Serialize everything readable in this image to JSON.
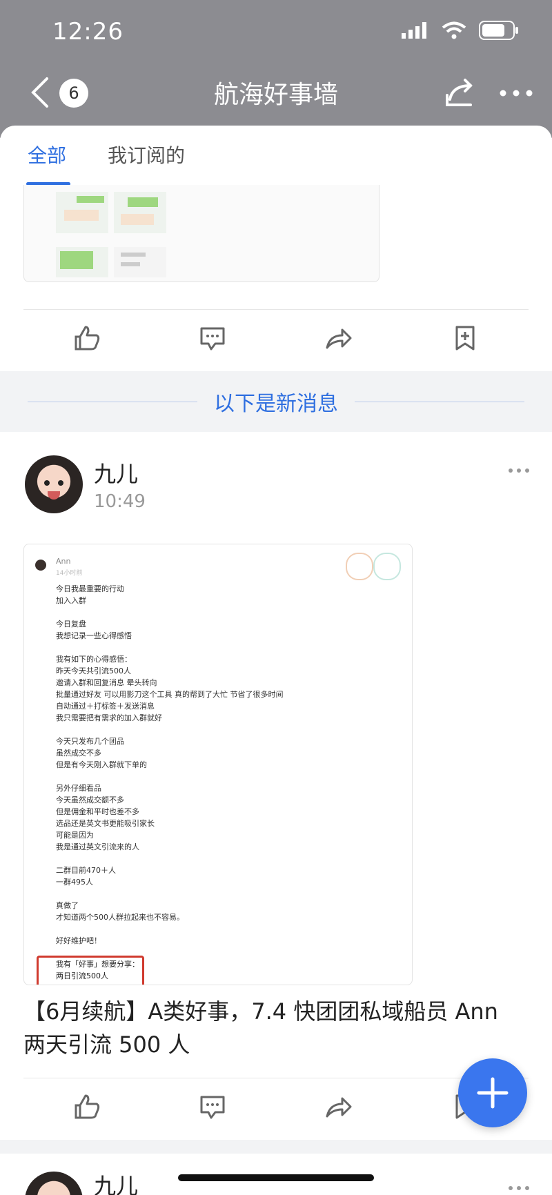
{
  "status_bar": {
    "time": "12:26"
  },
  "nav": {
    "title": "航海好事墙",
    "badge": "6"
  },
  "tabs": [
    {
      "label": "全部"
    },
    {
      "label": "我订阅的"
    }
  ],
  "separator": {
    "text": "以下是新消息"
  },
  "post": {
    "author": "九儿",
    "time": "10:49",
    "title": "【6月续航】A类好事，7.4 快团团私域船员 Ann 两天引流 500 人",
    "screenshot": {
      "name": "Ann",
      "time": "14小时前",
      "body": "今日我最重要的行动\n加入入群\n\n今日复盘\n我想记录一些心得感悟\n\n我有如下的心得感悟：\n昨天今天共引流500人\n邀请入群和回复消息 晕头转向\n批量通过好友 可以用影刀这个工具 真的帮到了大忙 节省了很多时间\n自动通过＋打标签＋发送消息\n我只需要把有需求的加入群就好\n\n今天只发布几个团品\n虽然成交不多\n但是有今天刚入群就下单的\n\n另外仔细看品\n今天虽然成交额不多\n但是佣金和平时也差不多\n选品还是英文书更能吸引家长\n可能是因为\n我是通过英文引流来的人\n\n二群目前470＋人\n一群495人\n\n真做了\n才知道两个500人群拉起来也不容易。\n\n好好维护吧！",
      "highlight": "我有「好事」想要分享：\n两日引流500人"
    }
  },
  "next_post": {
    "author": "九儿"
  },
  "colors": {
    "accent": "#2f6fe0",
    "fab": "#3a76ee",
    "header": "#8c8c91",
    "highlight_box": "#d03a2e"
  },
  "icons": [
    "back-icon",
    "share-icon",
    "more-icon",
    "like-icon",
    "comment-icon",
    "forward-icon",
    "bookmark-icon",
    "plus-icon"
  ]
}
